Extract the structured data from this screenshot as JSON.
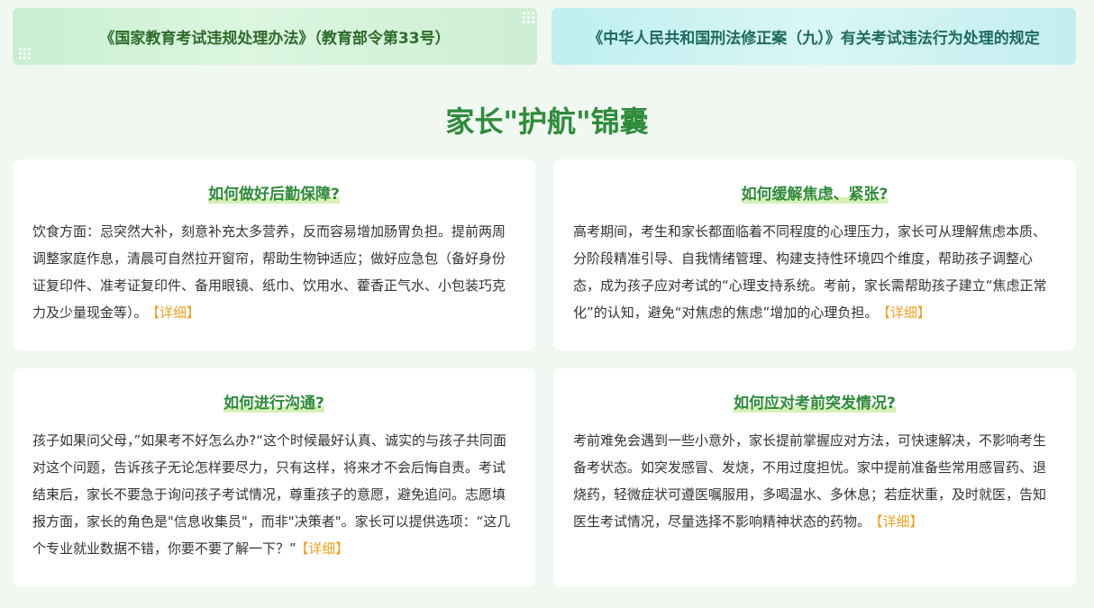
{
  "banners": {
    "left": "《国家教育考试违规处理办法》（教育部令第33号）",
    "right": "《中华人民共和国刑法修正案（九）》有关考试违法行为处理的规定"
  },
  "section_title": "家长\"护航\"锦囊",
  "cards": [
    {
      "title": "如何做好后勤保障?",
      "body": "饮食方面：忌突然大补，刻意补充太多营养，反而容易增加肠胃负担。提前两周调整家庭作息，清晨可自然拉开窗帘，帮助生物钟适应；做好应急包（备好身份证复印件、准考证复印件、备用眼镜、纸巾、饮用水、藿香正气水、小包装巧克力及少量现金等）。",
      "link": "【详细】"
    },
    {
      "title": "如何缓解焦虑、紧张?",
      "body": "高考期间，考生和家长都面临着不同程度的心理压力，家长可从理解焦虑本质、分阶段精准引导、自我情绪管理、构建支持性环境四个维度，帮助孩子调整心态，成为孩子应对考试的“心理支持系统。考前，家长需帮助孩子建立“焦虑正常化”的认知，避免“对焦虑的焦虑”增加的心理负担。",
      "link": "【详细】"
    },
    {
      "title": "如何进行沟通?",
      "body": "孩子如果问父母，”如果考不好怎么办?“这个时候最好认真、诚实的与孩子共同面对这个问题，告诉孩子无论怎样要尽力，只有这样，将来才不会后悔自责。考试结束后，家长不要急于询问孩子考试情况，尊重孩子的意愿，避免追问。志愿填报方面，家长的角色是\"信息收集员\"，而非\"决策者\"。家长可以提供选项：“这几个专业就业数据不错，你要不要了解一下？”",
      "link": "【详细】"
    },
    {
      "title": "如何应对考前突发情况?",
      "body": "考前难免会遇到一些小意外，家长提前掌握应对方法，可快速解决，不影响考生备考状态。如突发感冒、发烧，不用过度担忧。家中提前准备些常用感冒药、退烧药，轻微症状可遵医嘱服用，多喝温水、多休息；若症状重，及时就医，告知医生考试情况，尽量选择不影响精神状态的药物。",
      "link": "【详细】"
    }
  ]
}
